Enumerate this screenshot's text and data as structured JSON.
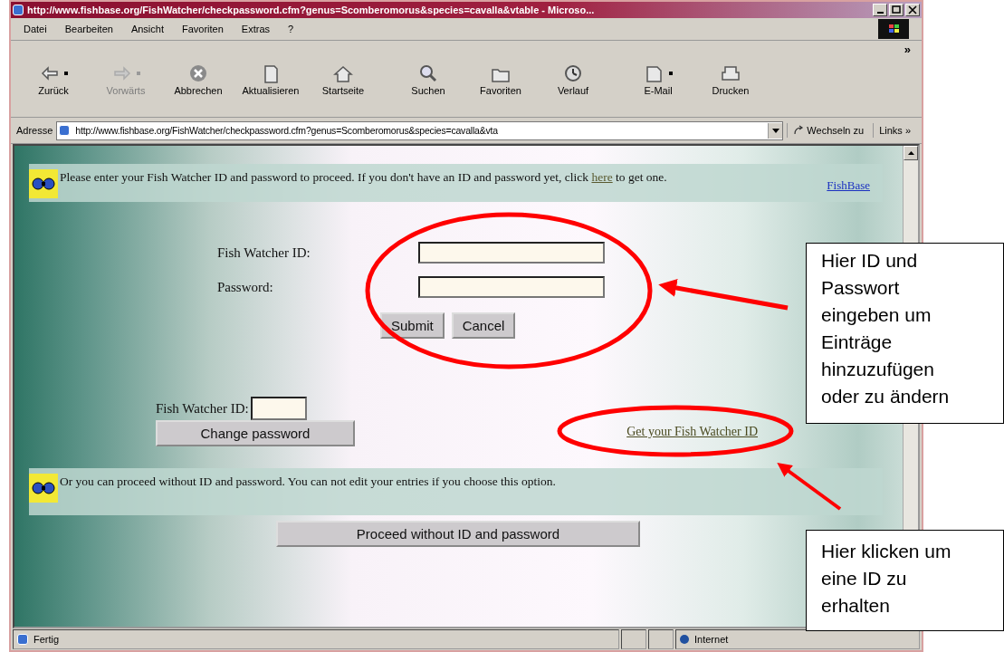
{
  "window": {
    "title": "http://www.fishbase.org/FishWatcher/checkpassword.cfm?genus=Scomberomorus&species=cavalla&vtable - Microso..."
  },
  "menu": [
    "Datei",
    "Bearbeiten",
    "Ansicht",
    "Favoriten",
    "Extras",
    "?"
  ],
  "toolbar": [
    {
      "kind": "back",
      "label": "Zurück",
      "disabled": false,
      "dropdown": true
    },
    {
      "kind": "forward",
      "label": "Vorwärts",
      "disabled": true,
      "dropdown": true
    },
    {
      "kind": "stop",
      "label": "Abbrechen",
      "disabled": false,
      "dropdown": false
    },
    {
      "kind": "refresh",
      "label": "Aktualisieren",
      "disabled": false,
      "dropdown": false
    },
    {
      "kind": "home",
      "label": "Startseite",
      "disabled": false,
      "dropdown": false
    },
    {
      "kind": "search",
      "label": "Suchen",
      "disabled": false,
      "dropdown": false
    },
    {
      "kind": "favorites",
      "label": "Favoriten",
      "disabled": false,
      "dropdown": false
    },
    {
      "kind": "history",
      "label": "Verlauf",
      "disabled": false,
      "dropdown": false
    },
    {
      "kind": "mail",
      "label": "E-Mail",
      "disabled": false,
      "dropdown": true
    },
    {
      "kind": "print",
      "label": "Drucken",
      "disabled": false,
      "dropdown": false
    }
  ],
  "toolbar_more": "»",
  "address_bar": {
    "label": "Adresse",
    "url": "http://www.fishbase.org/FishWatcher/checkpassword.cfm?genus=Scomberomorus&species=cavalla&vta",
    "go": "Wechseln zu",
    "links": "Links »"
  },
  "notice": {
    "text": "Please enter your Fish Watcher ID and password to proceed. If you don't have an ID and password yet, click",
    "link": "here",
    "text_after": "to get one.",
    "side_link": "FishBase"
  },
  "login": {
    "id_label": "Fish Watcher ID:",
    "password_label": "Password:",
    "buttons": [
      "Submit",
      "Cancel"
    ]
  },
  "change": {
    "id_label": "Fish Watcher ID:",
    "button": "Change password",
    "link": "Get your Fish Watcher ID"
  },
  "notice2": {
    "text": "Or you can proceed without ID and password. You can not edit your entries if you choose this option."
  },
  "proceed_button": "Proceed without ID and password",
  "status_bar": {
    "text": "Fertig",
    "zone": "Internet"
  },
  "annotations": [
    {
      "text": "Hier ID und Passwort eingeben um Einträge hinzuzufügen oder zu ändern"
    },
    {
      "text": "Hier klicken um eine ID zu erhalten"
    }
  ]
}
